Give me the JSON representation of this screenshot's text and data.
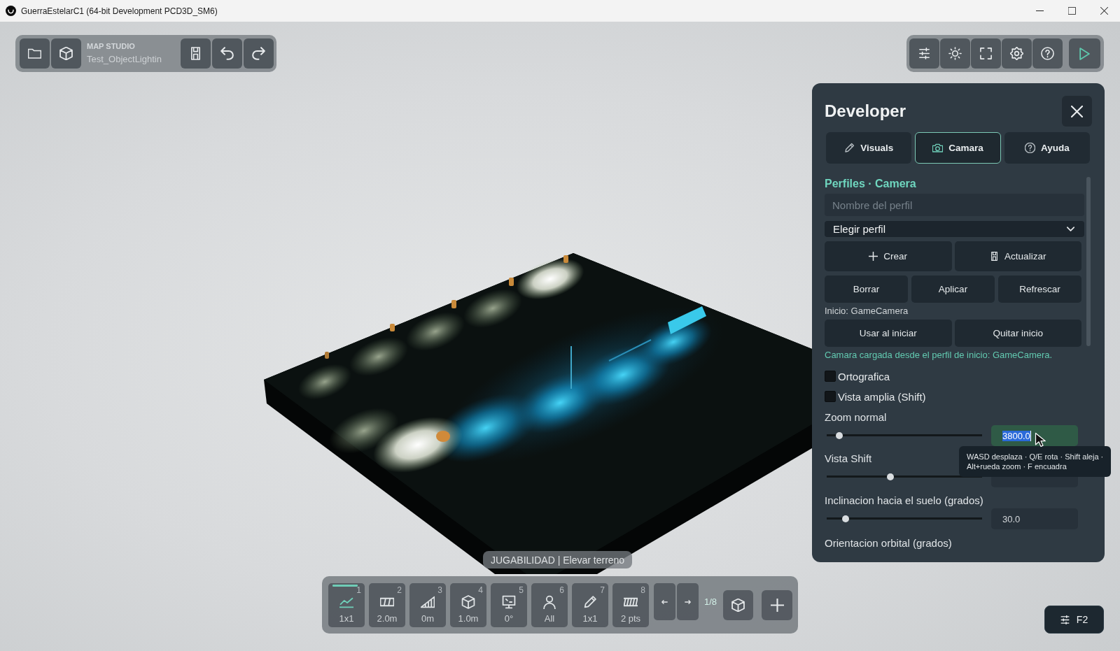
{
  "window": {
    "title": "GuerraEstelarC1 (64-bit Development PCD3D_SM6)"
  },
  "map_toolbar": {
    "app_label": "MAP STUDIO",
    "map_name": "Test_ObjectLightin"
  },
  "developer_panel": {
    "title": "Developer",
    "tabs": [
      {
        "label": "Visuals",
        "selected": false
      },
      {
        "label": "Camara",
        "selected": true
      },
      {
        "label": "Ayuda",
        "selected": false
      }
    ],
    "section_title": "Perfiles · Camera",
    "profile_name": {
      "placeholder": "Nombre del perfil"
    },
    "profile_select": {
      "value": "Elegir perfil"
    },
    "action_rows": [
      [
        "Crear",
        "Actualizar"
      ],
      [
        "Borrar",
        "Aplicar",
        "Refrescar"
      ]
    ],
    "startup_label": "Inicio: GameCamera",
    "startup_actions": [
      "Usar al iniciar",
      "Quitar inicio"
    ],
    "status_message": "Camara cargada desde el perfil de inicio: GameCamera.",
    "checkboxes": [
      {
        "label": "Ortografica",
        "checked": false
      },
      {
        "label": "Vista amplia (Shift)",
        "checked": false
      }
    ],
    "sliders": [
      {
        "label": "Zoom normal",
        "level": 0.08,
        "value": "3800.0",
        "focused": true
      },
      {
        "label": "Vista Shift",
        "level": 0.41,
        "focused": false
      },
      {
        "label": "Inclinacion hacia el suelo (grados)",
        "level": 0.12,
        "value": "30.0",
        "focused": false
      }
    ],
    "next_label": "Orientacion orbital (grados)"
  },
  "tooltip": {
    "lines": [
      "WASD desplaza · Q/E rota · Shift aleja ·",
      "Alt+rueda zoom · F encuadra"
    ]
  },
  "mode_label": {
    "text": "JUGABILIDAD | Elevar terreno"
  },
  "tool_bar": {
    "tools": [
      {
        "number": "1",
        "label": "1x1",
        "selected": true
      },
      {
        "number": "2",
        "label": "2.0m",
        "selected": false
      },
      {
        "number": "3",
        "label": "0m",
        "selected": false
      },
      {
        "number": "4",
        "label": "1.0m",
        "selected": false
      },
      {
        "number": "5",
        "label": "0°",
        "selected": false
      },
      {
        "number": "6",
        "label": "All",
        "selected": false
      },
      {
        "number": "7",
        "label": "1x1",
        "selected": false
      },
      {
        "number": "8",
        "label": "2 pts",
        "selected": false
      }
    ],
    "page": "1/8"
  },
  "f2_button": {
    "label": "F2"
  }
}
